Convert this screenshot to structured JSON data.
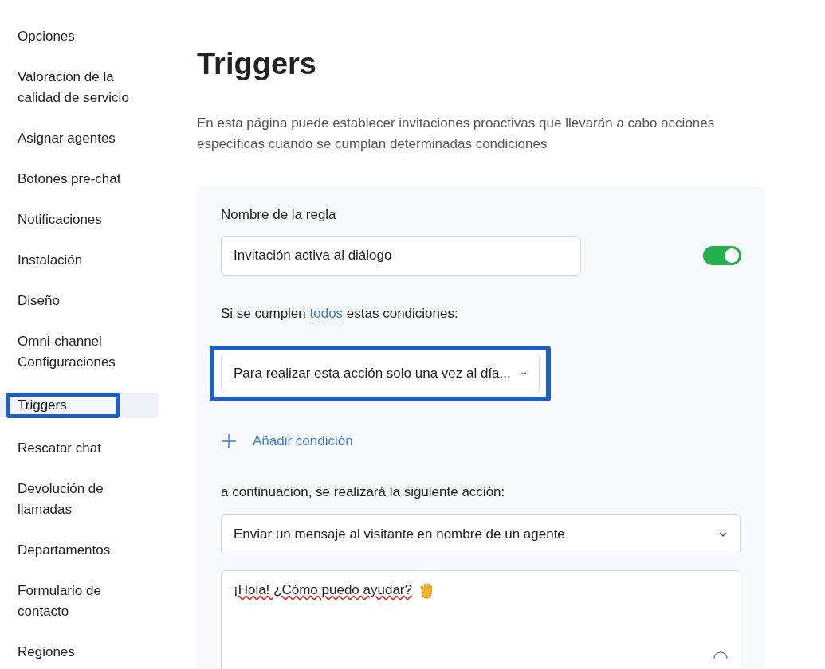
{
  "sidebar": {
    "items": [
      {
        "label": "Opciones",
        "selected": false,
        "highlighted": false
      },
      {
        "label": "Valoración de la calidad de servicio",
        "selected": false,
        "highlighted": false
      },
      {
        "label": "Asignar agentes",
        "selected": false,
        "highlighted": false
      },
      {
        "label": "Botones pre-chat",
        "selected": false,
        "highlighted": false
      },
      {
        "label": "Notificaciones",
        "selected": false,
        "highlighted": false
      },
      {
        "label": "Instalación",
        "selected": false,
        "highlighted": false
      },
      {
        "label": "Diseño",
        "selected": false,
        "highlighted": false
      },
      {
        "label": "Omni-channel Configuraciones",
        "selected": false,
        "highlighted": false
      },
      {
        "label": "Triggers",
        "selected": true,
        "highlighted": true
      },
      {
        "label": "Rescatar chat",
        "selected": false,
        "highlighted": false
      },
      {
        "label": "Devolución de llamadas",
        "selected": false,
        "highlighted": false
      },
      {
        "label": "Departamentos",
        "selected": false,
        "highlighted": false
      },
      {
        "label": "Formulario de contacto",
        "selected": false,
        "highlighted": false
      },
      {
        "label": "Regiones",
        "selected": false,
        "highlighted": false
      }
    ]
  },
  "page": {
    "title": "Triggers",
    "description": "En esta página puede establecer invitaciones proactivas que llevarán a cabo acciones específicas cuando se cumplan determinadas condiciones"
  },
  "rule": {
    "name_label": "Nombre de la regla",
    "name_value": "Invitación activa al diálogo",
    "enabled": true,
    "conditions_prefix": "Si se cumplen",
    "conditions_link": "todos",
    "conditions_suffix": "estas condiciones:",
    "condition": {
      "value": "Para realizar esta acción solo una vez al día...",
      "highlighted": true
    },
    "add_condition": "Añadir condición",
    "action_label": "a continuación, se realizará la siguiente acción:",
    "action": {
      "value": "Enviar un mensaje al visitante en nombre de un agente"
    },
    "message": {
      "value": "¡Hola! ¿Cómo puedo ayudar?"
    }
  }
}
